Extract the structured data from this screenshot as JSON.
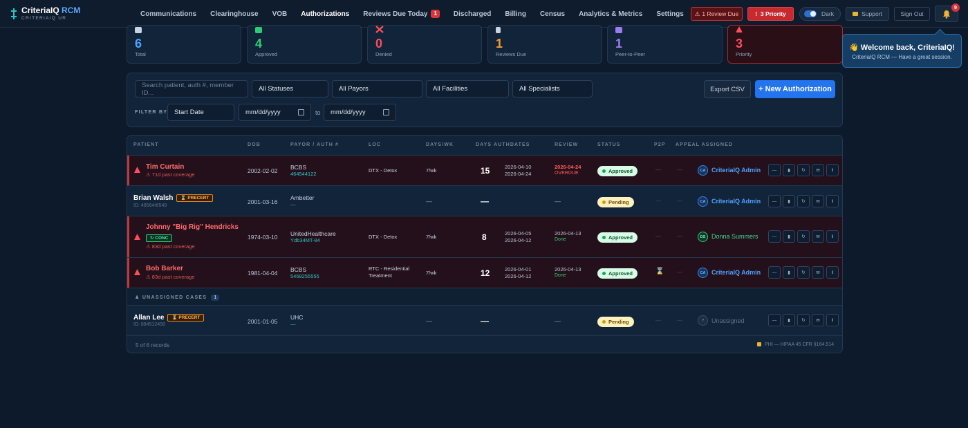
{
  "brand": {
    "name": "CriteriaIQ",
    "name_accent": "RCM",
    "subtitle": "CRITERIAIQ UR"
  },
  "nav": {
    "items": [
      {
        "label": "Communications"
      },
      {
        "label": "Clearinghouse"
      },
      {
        "label": "VOB"
      },
      {
        "label": "Authorizations",
        "active": true
      },
      {
        "label": "Reviews Due Today",
        "badge": "1"
      },
      {
        "label": "Discharged"
      },
      {
        "label": "Billing"
      },
      {
        "label": "Census"
      },
      {
        "label": "Analytics & Metrics"
      },
      {
        "label": "Settings"
      }
    ],
    "review_due_label": "1 Review Due",
    "priority_label": "3 Priority",
    "theme_label": "Dark",
    "support_label": "Support",
    "signout_label": "Sign Out",
    "notification_count": "9"
  },
  "stats": [
    {
      "value": "6",
      "label": "Total",
      "color": "#4ea1ff",
      "icon": "clipboard-icon"
    },
    {
      "value": "4",
      "label": "Approved",
      "color": "#2ecc71",
      "icon": "check-icon"
    },
    {
      "value": "0",
      "label": "Denied",
      "color": "#ff4d5a",
      "icon": "x-icon"
    },
    {
      "value": "1",
      "label": "Reviews Due",
      "color": "#f39c32",
      "icon": "hourglass-icon"
    },
    {
      "value": "1",
      "label": "Peer-to-Peer",
      "color": "#9b7cf0",
      "icon": "people-icon"
    },
    {
      "value": "3",
      "label": "Priority",
      "color": "#ff4d5a",
      "icon": "warning-icon"
    }
  ],
  "toast": {
    "title": "👋 Welcome back, CriteriaIQ!",
    "message": "CriteriaIQ RCM — Have a great session."
  },
  "filters": {
    "search_placeholder": "Search patient, auth #, member ID...",
    "status": "All Statuses",
    "payor": "All Payors",
    "facility": "All Facilities",
    "specialist": "All Specialists",
    "filter_by_label": "FILTER BY:",
    "date_field": "Start Date",
    "date_from": "mm/dd/yyyy",
    "to_label": "to",
    "date_to": "mm/dd/yyyy",
    "export_label": "Export CSV",
    "new_label": "+ New Authorization"
  },
  "table": {
    "headers": [
      "PATIENT",
      "DOB",
      "PAYOR / AUTH #",
      "LOC",
      "DAYS/WK",
      "DAYS AUTHDATES",
      "REVIEW",
      "STATUS",
      "P2P",
      "APPEAL ASSIGNED"
    ],
    "rows": [
      {
        "name": "Tim Curtain",
        "sub": "⚠ 71d past coverage",
        "dob": "2002-02-02",
        "payor": "BCBS",
        "auth": "464544122",
        "loc1": "DTX - Detox",
        "loc2": "",
        "days_wk": "7/wk",
        "days": "15",
        "date1": "2026-04-10",
        "date2": "2026-04-24",
        "review": "2026-04-24",
        "review_note": "OVERDUE",
        "status": "Approved",
        "p2p": "—",
        "appeal": "—",
        "assignee_initials": "CA",
        "assignee": "CriteriaIQ Admin"
      },
      {
        "name": "Brian Walsh",
        "tag": "⌛ PRECERT",
        "pid": "ID: 48564r6549",
        "dob": "2001-03-16",
        "payor": "Ambetter",
        "auth": "—",
        "loc1": "",
        "days_wk": "—",
        "days": "—",
        "review": "—",
        "status": "Pending",
        "p2p": "—",
        "appeal": "—",
        "assignee_initials": "CA",
        "assignee": "CriteriaIQ Admin"
      },
      {
        "name": "Johnny \"Big Rig\" Hendricks",
        "tag": "↻ CONC",
        "sub": "⚠ 83d past coverage",
        "dob": "1974-03-10",
        "payor": "UnitedHealthcare",
        "auth": "Ydb34MT-84",
        "loc1": "DTX - Detox",
        "days_wk": "7/wk",
        "days": "8",
        "date1": "2026-04-05",
        "date2": "2026-04-12",
        "review": "2026-04-13",
        "review_note": "Done",
        "status": "Approved",
        "p2p": "—",
        "appeal": "—",
        "assignee_initials": "DS",
        "assignee": "Donna Summers"
      },
      {
        "name": "Bob Barker",
        "sub": "⚠ 83d past coverage",
        "dob": "1981-04-04",
        "payor": "BCBS",
        "auth": "5468255555",
        "loc1": "RTC - Residential",
        "loc2": "Treatment",
        "days_wk": "7/wk",
        "days": "12",
        "date1": "2026-04-01",
        "date2": "2026-04-12",
        "review": "2026-04-13",
        "review_note": "Done",
        "status": "Approved",
        "p2p": "⌛",
        "appeal": "—",
        "assignee_initials": "CA",
        "assignee": "CriteriaIQ Admin"
      }
    ],
    "unassigned_label": "UNASSIGNED CASES",
    "unassigned_count": "1",
    "unassigned_rows": [
      {
        "name": "Allan Lee",
        "tag": "⌛ PRECERT",
        "pid": "ID: 884512458",
        "dob": "2001-01-05",
        "payor": "UHC",
        "auth": "—",
        "days_wk": "—",
        "days": "—",
        "review": "—",
        "status": "Pending",
        "p2p": "—",
        "appeal": "—",
        "assignee_initials": "?",
        "assignee": "Unassigned"
      }
    ],
    "footer_count": "5 of 6 records",
    "footer_note": "PHI — HIPAA 45 CFR §164.514"
  }
}
